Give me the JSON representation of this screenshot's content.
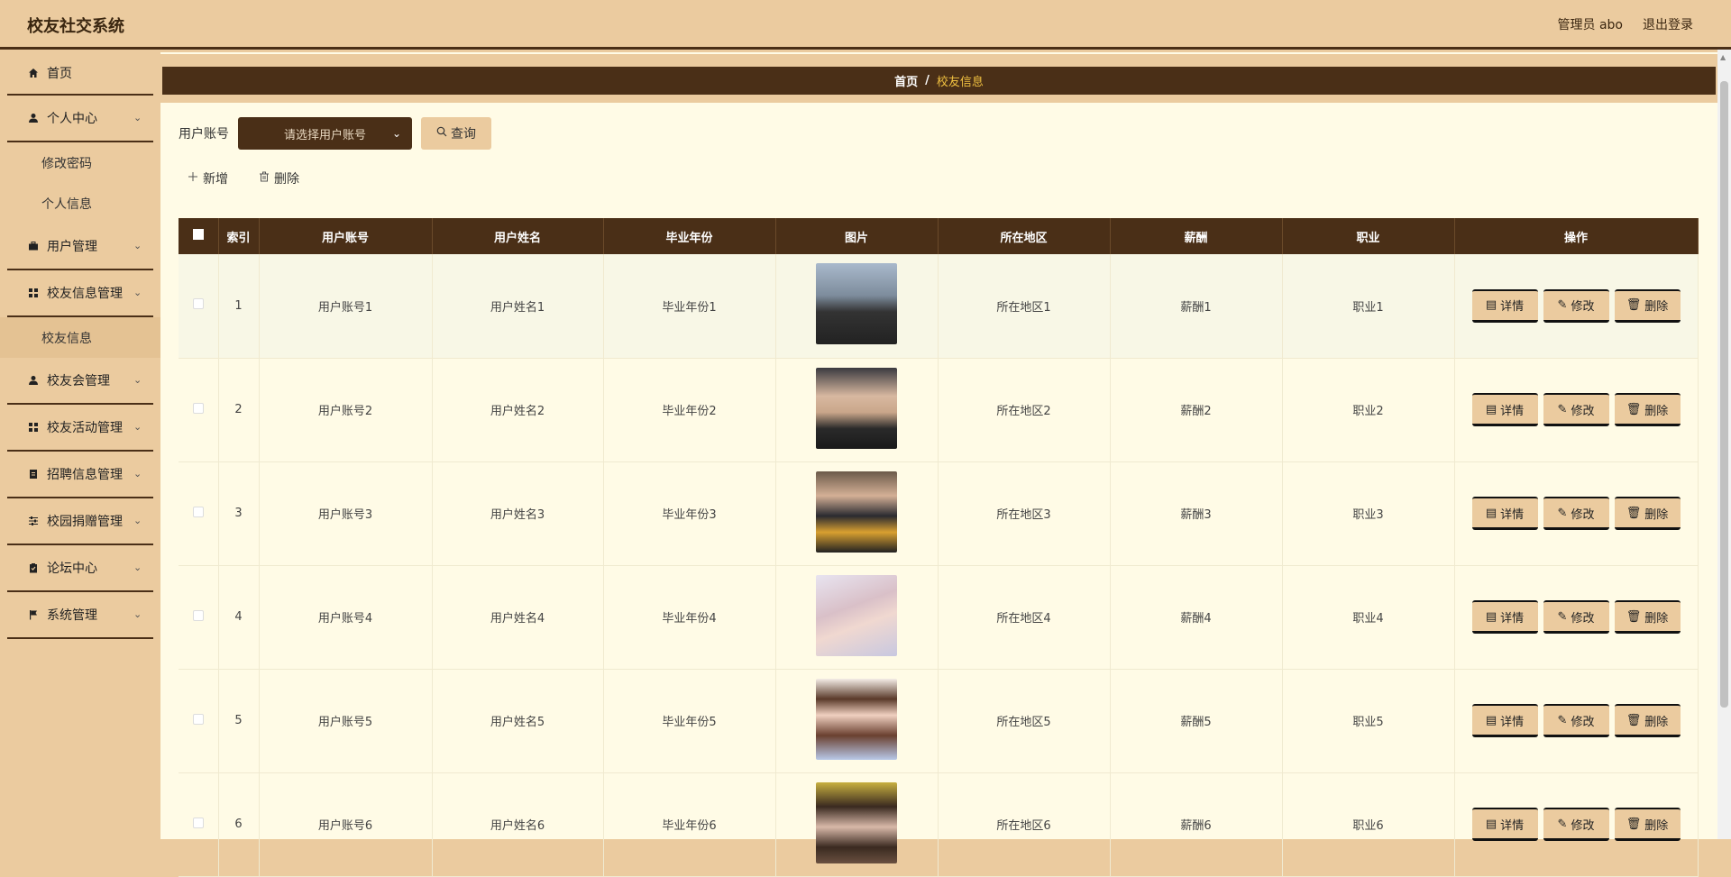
{
  "app": {
    "title": "校友社交系统"
  },
  "header": {
    "admin_label": "管理员 abo",
    "logout_label": "退出登录"
  },
  "sidebar": {
    "home": "首页",
    "personal_center": "个人中心",
    "personal_sub": [
      "修改密码",
      "个人信息"
    ],
    "user_mgmt": "用户管理",
    "alumni_info_mgmt": "校友信息管理",
    "alumni_info_sub": [
      "校友信息"
    ],
    "alumni_assoc_mgmt": "校友会管理",
    "alumni_activity_mgmt": "校友活动管理",
    "recruit_mgmt": "招聘信息管理",
    "donation_mgmt": "校园捐赠管理",
    "forum_center": "论坛中心",
    "system_mgmt": "系统管理"
  },
  "breadcrumb": {
    "home": "首页",
    "separator": "/",
    "current": "校友信息"
  },
  "search": {
    "label": "用户账号",
    "placeholder": "请选择用户账号",
    "query_label": "查询"
  },
  "actions": {
    "add_label": "新增",
    "delete_label": "删除"
  },
  "table": {
    "headers": [
      "索引",
      "用户账号",
      "用户姓名",
      "毕业年份",
      "图片",
      "所在地区",
      "薪酬",
      "职业",
      "操作"
    ],
    "op_labels": {
      "detail": "详情",
      "edit": "修改",
      "delete": "删除"
    },
    "rows": [
      {
        "index": "1",
        "account": "用户账号1",
        "name": "用户姓名1",
        "year": "毕业年份1",
        "region": "所在地区1",
        "salary": "薪酬1",
        "job": "职业1"
      },
      {
        "index": "2",
        "account": "用户账号2",
        "name": "用户姓名2",
        "year": "毕业年份2",
        "region": "所在地区2",
        "salary": "薪酬2",
        "job": "职业2"
      },
      {
        "index": "3",
        "account": "用户账号3",
        "name": "用户姓名3",
        "year": "毕业年份3",
        "region": "所在地区3",
        "salary": "薪酬3",
        "job": "职业3"
      },
      {
        "index": "4",
        "account": "用户账号4",
        "name": "用户姓名4",
        "year": "毕业年份4",
        "region": "所在地区4",
        "salary": "薪酬4",
        "job": "职业4"
      },
      {
        "index": "5",
        "account": "用户账号5",
        "name": "用户姓名5",
        "year": "毕业年份5",
        "region": "所在地区5",
        "salary": "薪酬5",
        "job": "职业5"
      },
      {
        "index": "6",
        "account": "用户账号6",
        "name": "用户姓名6",
        "year": "毕业年份6",
        "region": "所在地区6",
        "salary": "薪酬6",
        "job": "职业6"
      }
    ]
  },
  "colors": {
    "brand_dark": "#4a2f17",
    "accent_tan": "#ebcb9f",
    "bg_cream": "#fffbe6",
    "breadcrumb_current": "#f0c040"
  }
}
